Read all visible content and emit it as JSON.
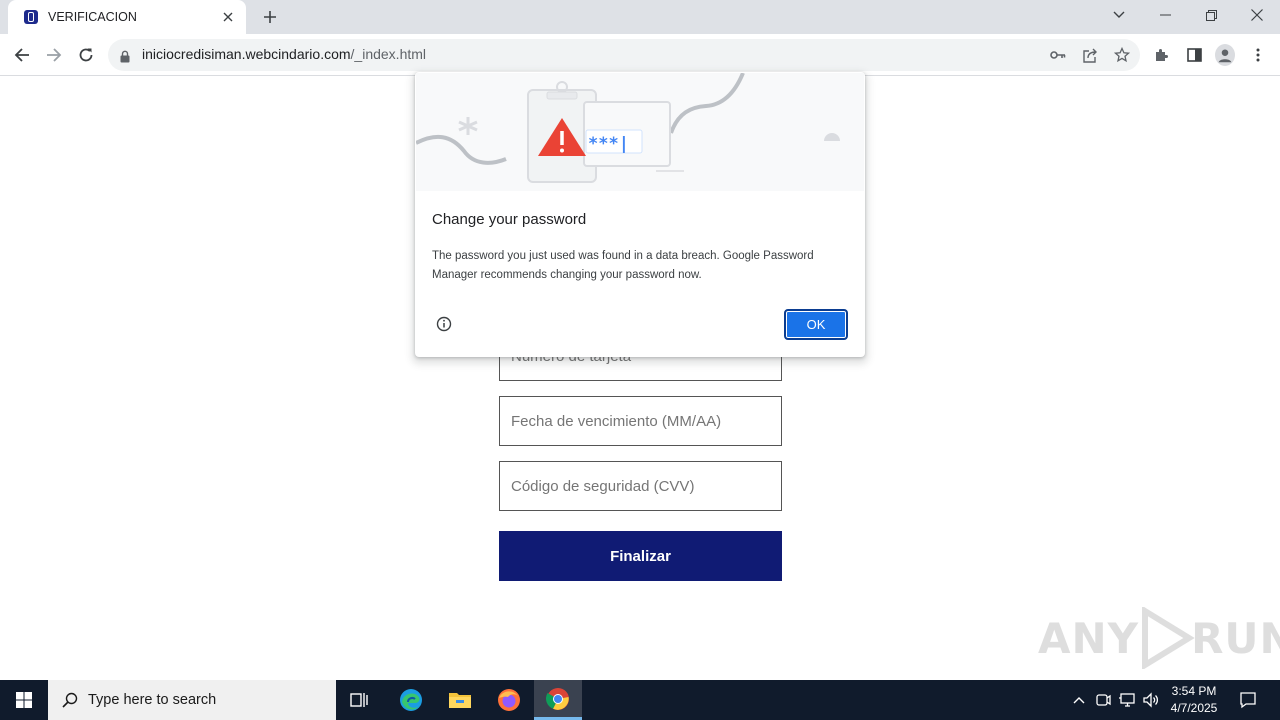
{
  "browser": {
    "tab_title": "VERIFICACION",
    "url_domain": "iniciocredisiman.webcindario.com",
    "url_path": "/_index.html"
  },
  "form": {
    "card_number_placeholder": "Número de tarjeta",
    "expiry_placeholder": "Fecha de vencimiento (MM/AA)",
    "cvv_placeholder": "Código de seguridad (CVV)",
    "submit_label": "Finalizar"
  },
  "dialog": {
    "title": "Change your password",
    "body": "The password you just used was found in a data breach. Google Password Manager recommends changing your password now.",
    "ok_label": "OK",
    "illustration_text": "***|"
  },
  "taskbar": {
    "search_placeholder": "Type here to search",
    "time": "3:54 PM",
    "date": "4/7/2025"
  },
  "watermark": {
    "text_left": "ANY",
    "text_right": "RUN"
  },
  "colors": {
    "submit_bg": "#101b74",
    "ok_button": "#1a73e8",
    "warning_red": "#ea4335",
    "taskbar": "#101b2c"
  }
}
